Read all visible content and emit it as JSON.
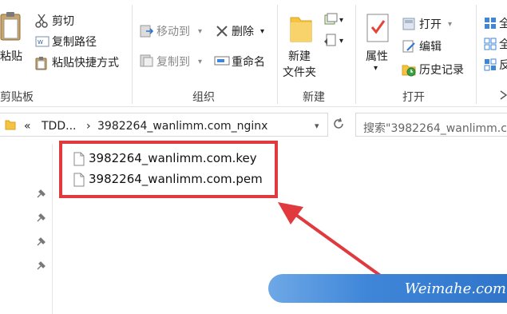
{
  "ribbon": {
    "clipboard": {
      "paste_label": "粘贴",
      "cut_label": "剪切",
      "copy_path_label": "复制路径",
      "paste_shortcut_label": "粘贴快捷方式",
      "group_label": "剪贴板"
    },
    "organize": {
      "move_to_label": "移动到",
      "copy_to_label": "复制到",
      "delete_label": "删除",
      "rename_label": "重命名",
      "group_label": "组织"
    },
    "new": {
      "new_folder_line1": "新建",
      "new_folder_line2": "文件夹",
      "group_label": "新建"
    },
    "open": {
      "properties_label": "属性",
      "open_label": "打开",
      "edit_label": "编辑",
      "history_label": "历史记录",
      "group_label": "打开"
    },
    "select": {
      "item1_label": "全",
      "item2_label": "全",
      "item3_label": "反"
    }
  },
  "address": {
    "chevron": "«",
    "crumb_parent": "TDD...",
    "separator": "›",
    "crumb_current": "3982264_wanlimm.com_nginx",
    "search_placeholder": "搜索\"3982264_wanlimm.c"
  },
  "files": [
    {
      "name": "3982264_wanlimm.com.key"
    },
    {
      "name": "3982264_wanlimm.com.pem"
    }
  ],
  "watermark": {
    "text": "Weimahe.com"
  },
  "colors": {
    "highlight": "#e03a3e",
    "folder": "#f5c342",
    "watermark": "#3f86d9"
  }
}
